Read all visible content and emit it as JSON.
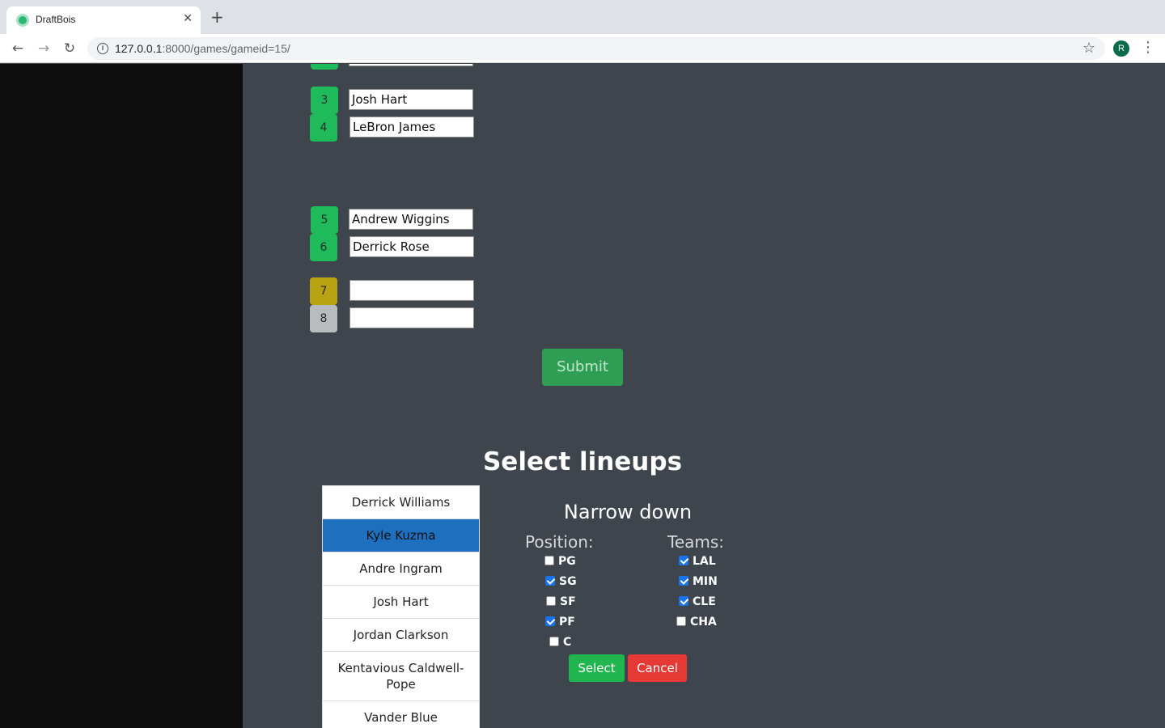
{
  "browser": {
    "tab_title": "DraftBois",
    "tab_close": "✕",
    "new_tab": "+",
    "url_host": "127.0.0.1",
    "url_path": ":8000/games/gameid=15/",
    "profile_initial": "R"
  },
  "draft": {
    "picks": [
      {
        "number": "3",
        "player": "Josh Hart",
        "status": "done"
      },
      {
        "number": "4",
        "player": "LeBron James",
        "status": "done"
      },
      {
        "number": "5",
        "player": "Andrew Wiggins",
        "status": "done"
      },
      {
        "number": "6",
        "player": "Derrick Rose",
        "status": "done"
      },
      {
        "number": "7",
        "player": "",
        "status": "current"
      },
      {
        "number": "8",
        "player": "",
        "status": "pending"
      }
    ],
    "submit_label": "Submit"
  },
  "lineups": {
    "title": "Select lineups",
    "players": [
      "Derrick Williams",
      "Kyle Kuzma",
      "Andre Ingram",
      "Josh Hart",
      "Jordan Clarkson",
      "Kentavious Caldwell-Pope",
      "Vander Blue"
    ],
    "selected_player": "Kyle Kuzma"
  },
  "filters": {
    "title": "Narrow down",
    "position_label": "Position:",
    "teams_label": "Teams:",
    "positions": [
      {
        "label": "PG",
        "checked": false
      },
      {
        "label": "SG",
        "checked": true
      },
      {
        "label": "SF",
        "checked": false
      },
      {
        "label": "PF",
        "checked": true
      },
      {
        "label": "C",
        "checked": false
      }
    ],
    "teams": [
      {
        "label": "LAL",
        "checked": true
      },
      {
        "label": "MIN",
        "checked": true
      },
      {
        "label": "CLE",
        "checked": true
      },
      {
        "label": "CHA",
        "checked": false
      }
    ],
    "select_label": "Select",
    "cancel_label": "Cancel"
  },
  "colors": {
    "pick_done": "#1fbb5a",
    "pick_current": "#b8a313",
    "pick_pending": "#b9bcbf",
    "selected_row": "#1f6fbf",
    "select_button": "#20b54f",
    "cancel_button": "#e53935"
  }
}
